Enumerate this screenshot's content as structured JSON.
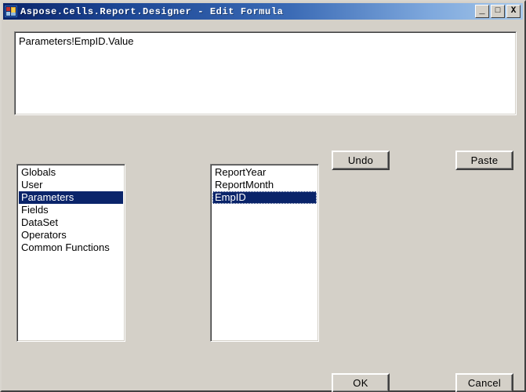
{
  "window": {
    "title": "Aspose.Cells.Report.Designer - Edit Formula",
    "icon": "app-grid-icon",
    "colors": {
      "titlebar_start": "#0a246a",
      "titlebar_end": "#a6c8ea",
      "face": "#d4d0c8",
      "selection": "#0a246a",
      "text": "#000000"
    },
    "controls": {
      "minimize_label": "_",
      "maximize_label": "□",
      "close_label": "X"
    }
  },
  "formula": {
    "value": "Parameters!EmpID.Value",
    "placeholder": ""
  },
  "buttons": {
    "undo": "Undo",
    "paste": "Paste",
    "ok": "OK",
    "cancel": "Cancel"
  },
  "category_list": {
    "selected_index": 2,
    "items": [
      {
        "label": "Globals"
      },
      {
        "label": "User"
      },
      {
        "label": "Parameters"
      },
      {
        "label": "Fields"
      },
      {
        "label": "DataSet"
      },
      {
        "label": "Operators"
      },
      {
        "label": "Common Functions"
      }
    ]
  },
  "item_list": {
    "selected_index": 2,
    "items": [
      {
        "label": "ReportYear"
      },
      {
        "label": "ReportMonth"
      },
      {
        "label": "EmpID"
      }
    ]
  }
}
